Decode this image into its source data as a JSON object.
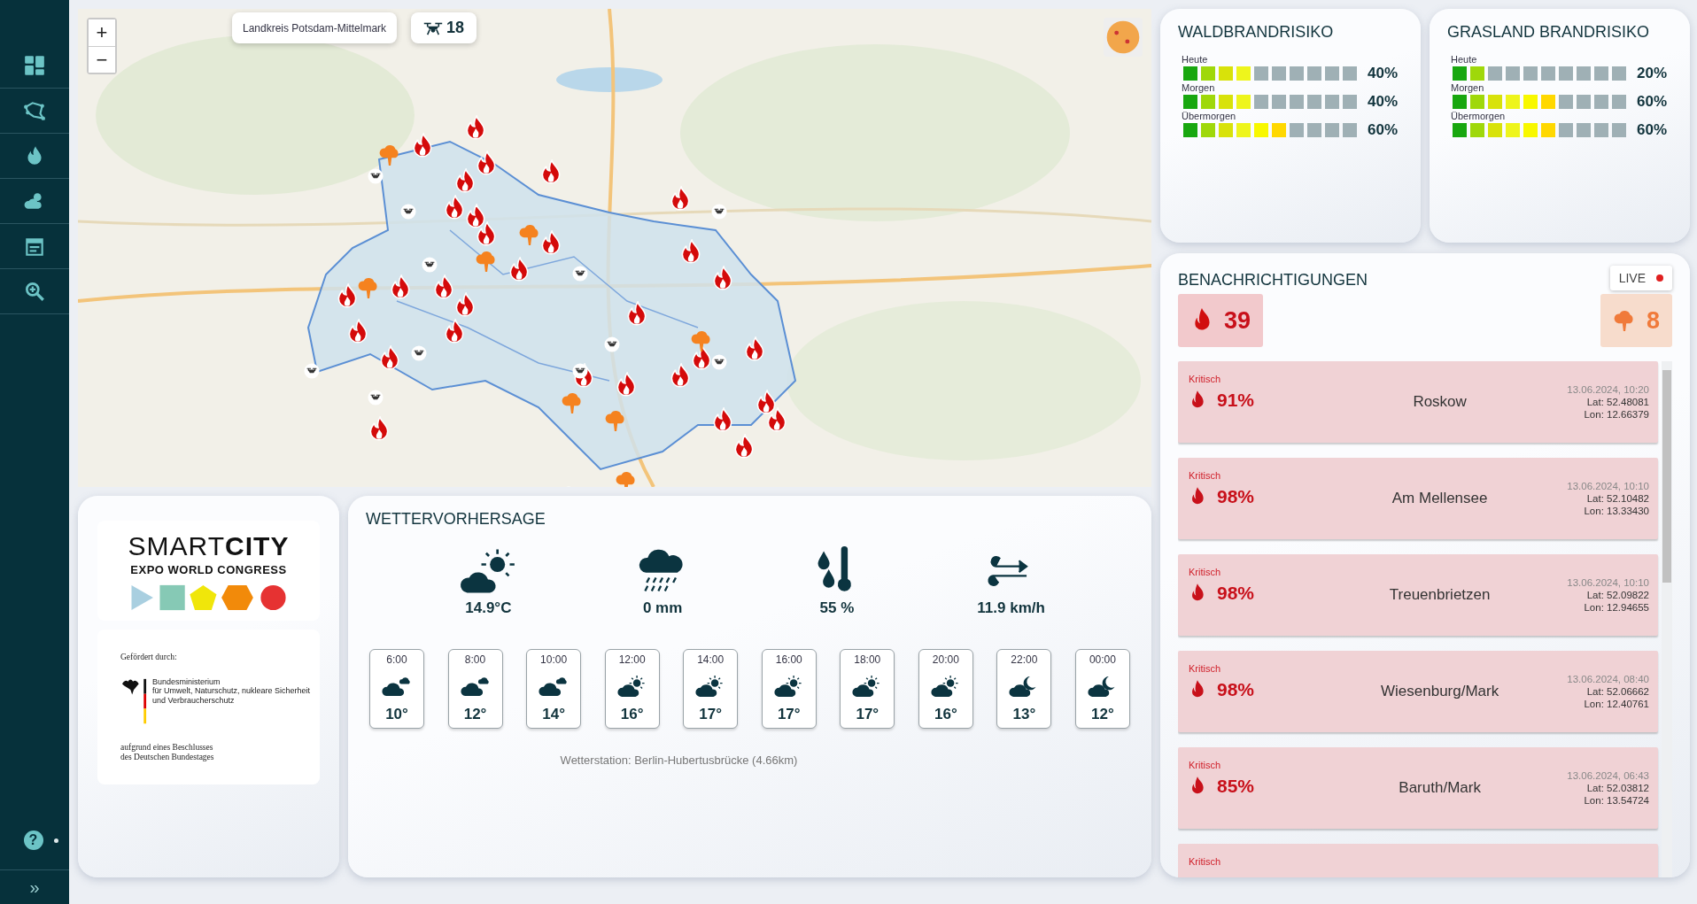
{
  "sidebar": {
    "items": [
      {
        "kind": "dashboard",
        "selected": false
      },
      {
        "kind": "regions",
        "selected": false
      },
      {
        "kind": "fire",
        "selected": false
      },
      {
        "kind": "weather",
        "selected": false
      },
      {
        "kind": "calendar",
        "selected": false
      },
      {
        "kind": "search",
        "selected": false
      }
    ],
    "help": "?",
    "expand": "»"
  },
  "map": {
    "zoom_in": "+",
    "zoom_out": "−",
    "region": "Landkreis Potsdam-Mittelmark",
    "drones": "18"
  },
  "wald": {
    "title": "WALDBRANDRISIKO",
    "rows": [
      {
        "label": "Heute",
        "level": 0.4,
        "reading": "40%"
      },
      {
        "label": "Morgen",
        "level": 0.4,
        "reading": "40%"
      },
      {
        "label": "Übermorgen",
        "level": 0.6,
        "reading": "60%"
      }
    ]
  },
  "gras": {
    "title": "GRASLAND BRANDRISIKO",
    "rows": [
      {
        "label": "Heute",
        "level": 0.2,
        "reading": "20%"
      },
      {
        "label": "Morgen",
        "level": 0.6,
        "reading": "60%"
      },
      {
        "label": "Übermorgen",
        "level": 0.6,
        "reading": "60%"
      }
    ]
  },
  "notifications": {
    "title": "BENACHRICHTIGUNGEN",
    "live": "LIVE",
    "fire_count": "39",
    "smoke_count": "8",
    "items": [
      {
        "status": "Kritisch",
        "value": "91%",
        "place": "Roskow",
        "time": "13.06.2024, 10:20",
        "lat": "Lat: 52.48081",
        "lon": "Lon: 12.66379"
      },
      {
        "status": "Kritisch",
        "value": "98%",
        "place": "Am Mellensee",
        "time": "13.06.2024, 10:10",
        "lat": "Lat: 52.10482",
        "lon": "Lon: 13.33430"
      },
      {
        "status": "Kritisch",
        "value": "98%",
        "place": "Treuenbrietzen",
        "time": "13.06.2024, 10:10",
        "lat": "Lat: 52.09822",
        "lon": "Lon: 12.94655"
      },
      {
        "status": "Kritisch",
        "value": "98%",
        "place": "Wiesenburg/Mark",
        "time": "13.06.2024, 08:40",
        "lat": "Lat: 52.06662",
        "lon": "Lon: 12.40761"
      },
      {
        "status": "Kritisch",
        "value": "85%",
        "place": "Baruth/Mark",
        "time": "13.06.2024, 06:43",
        "lat": "Lat: 52.03812",
        "lon": "Lon: 13.54724"
      },
      {
        "status": "Kritisch"
      }
    ]
  },
  "sponsor": {
    "logo": "SMART**CITY**",
    "logo_sub": "EXPO WORLD CONGRESS",
    "funded": "Gefördert durch:",
    "ministry": [
      "Bundesministerium",
      "für Umwelt, Naturschutz, nukleare Sicherheit",
      "und Verbraucherschutz"
    ],
    "decision": [
      "aufgrund eines Beschlusses",
      "des Deutschen Bundestages"
    ]
  },
  "weather": {
    "title": "WETTERVORHERSAGE",
    "metrics": [
      {
        "kind": "partly-sunny",
        "value": "14.9°C"
      },
      {
        "kind": "rain",
        "value": "0 mm"
      },
      {
        "kind": "humidity",
        "value": "55 %"
      },
      {
        "kind": "wind",
        "value": "11.9 km/h"
      }
    ],
    "hours": [
      {
        "time": "6:00",
        "kind": "cloudy",
        "temp": "10°"
      },
      {
        "time": "8:00",
        "kind": "cloudy",
        "temp": "12°"
      },
      {
        "time": "10:00",
        "kind": "cloudy",
        "temp": "14°"
      },
      {
        "time": "12:00",
        "kind": "partly-sunny",
        "temp": "16°"
      },
      {
        "time": "14:00",
        "kind": "partly-sunny",
        "temp": "17°"
      },
      {
        "time": "16:00",
        "kind": "partly-sunny",
        "temp": "17°"
      },
      {
        "time": "18:00",
        "kind": "partly-sunny",
        "temp": "17°"
      },
      {
        "time": "20:00",
        "kind": "partly-sunny",
        "temp": "16°"
      },
      {
        "time": "22:00",
        "kind": "night",
        "temp": "13°"
      },
      {
        "time": "00:00",
        "kind": "night",
        "temp": "12°"
      }
    ],
    "station": "Wetterstation: Berlin-Hubertusbrücke (4.66km)"
  }
}
